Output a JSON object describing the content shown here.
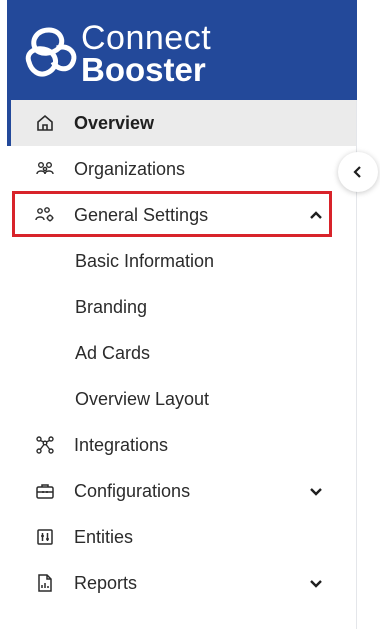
{
  "brand": {
    "line1": "Connect",
    "line2": "Booster",
    "header_color": "#23499a"
  },
  "nav": {
    "overview": {
      "label": "Overview",
      "icon": "home-icon"
    },
    "organizations": {
      "label": "Organizations",
      "icon": "users-icon"
    },
    "general_settings": {
      "label": "General Settings",
      "icon": "user-settings-icon",
      "expanded": true,
      "children": [
        "Basic Information",
        "Branding",
        "Ad Cards",
        "Overview Layout"
      ]
    },
    "integrations": {
      "label": "Integrations",
      "icon": "network-icon"
    },
    "configurations": {
      "label": "Configurations",
      "icon": "toolbox-icon"
    },
    "entities": {
      "label": "Entities",
      "icon": "sliders-icon"
    },
    "reports": {
      "label": "Reports",
      "icon": "report-icon"
    }
  },
  "colors": {
    "highlight": "#d8232a",
    "active_bg": "#ebebeb"
  }
}
